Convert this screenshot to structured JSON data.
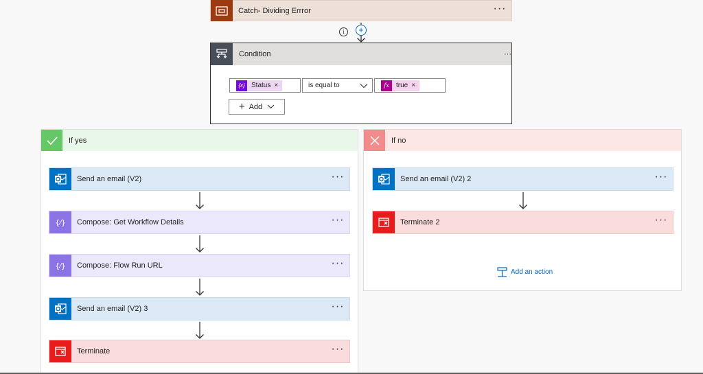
{
  "catch_step": {
    "title": "Catch- Dividing Errror",
    "more": "···"
  },
  "info_icon": "info-icon",
  "condition": {
    "title": "Condition",
    "more": "···",
    "left_operand": "Status",
    "operator": "is equal to",
    "right_operand": "true",
    "remove_glyph": "×",
    "add_label": "Add"
  },
  "if_yes": {
    "title": "If yes",
    "steps": [
      {
        "label": "Send an email (V2)",
        "icon": "outlook-icon"
      },
      {
        "label": "Compose: Get Workflow Details",
        "icon": "compose-icon"
      },
      {
        "label": "Compose: Flow Run URL",
        "icon": "compose-icon"
      },
      {
        "label": "Send an email (V2) 3",
        "icon": "outlook-icon"
      },
      {
        "label": "Terminate",
        "icon": "terminate-icon"
      }
    ]
  },
  "if_no": {
    "title": "If no",
    "steps": [
      {
        "label": "Send an email (V2) 2",
        "icon": "outlook-icon"
      },
      {
        "label": "Terminate 2",
        "icon": "terminate-icon"
      }
    ],
    "add_action_label": "Add an action"
  },
  "more_glyph": "···",
  "colors": {
    "catch_accent": "#9d3b10",
    "catch_bg": "#ede0d8",
    "condition_accent": "#484f58",
    "email_accent": "#0072c6",
    "email_bg": "#dbe9f6",
    "compose_accent": "#8b73e6",
    "compose_bg": "#ece8fb",
    "terminate_accent": "#e81c1c",
    "terminate_bg": "#fbdcdc",
    "yes_accent": "#66c766",
    "yes_bg": "#e9f7ea",
    "no_accent": "#f28b8b",
    "no_bg": "#fce6e6",
    "link": "#0066c4"
  }
}
